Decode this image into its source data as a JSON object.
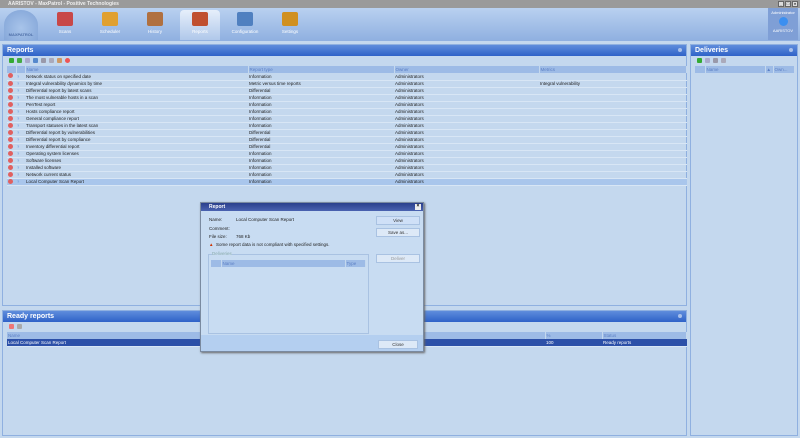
{
  "window": {
    "title": "AARISTOV - MaxPatrol - Positive Technologies",
    "controls": [
      "_",
      "□",
      "×"
    ]
  },
  "logo": "MAXPATROL",
  "tabs": [
    {
      "label": "Scans",
      "color": "#c84848"
    },
    {
      "label": "Scheduler",
      "color": "#e0a030"
    },
    {
      "label": "History",
      "color": "#b07040"
    },
    {
      "label": "Reports",
      "color": "#c05030"
    },
    {
      "label": "Configuration",
      "color": "#5080c0"
    },
    {
      "label": "Settings",
      "color": "#d09020"
    }
  ],
  "active_tab": "Reports",
  "admin": {
    "role": "Administrator",
    "user": "AARISTOV"
  },
  "reports": {
    "title": "Reports",
    "columns": [
      "Name",
      "Report type",
      "Owner",
      "Metrics"
    ],
    "rows": [
      [
        "Network status on specified date",
        "Information",
        "Administrators",
        ""
      ],
      [
        "Integral vulnerability dynamics by time",
        "Metric versus time reports",
        "Administrators",
        "Integral vulnerability"
      ],
      [
        "Differential report by latest scans",
        "Differential",
        "Administrators",
        ""
      ],
      [
        "The most vulnerable hosts in a scan",
        "Information",
        "Administrators",
        ""
      ],
      [
        "PenTest report",
        "Information",
        "Administrators",
        ""
      ],
      [
        "Hosts compliance report",
        "Information",
        "Administrators",
        ""
      ],
      [
        "General compliance report",
        "Information",
        "Administrators",
        ""
      ],
      [
        "Transport statuses in the latest scan",
        "Information",
        "Administrators",
        ""
      ],
      [
        "Differential report by vulnerabilities",
        "Differential",
        "Administrators",
        ""
      ],
      [
        "Differential report by compliance",
        "Differential",
        "Administrators",
        ""
      ],
      [
        "Inventory differential report",
        "Differential",
        "Administrators",
        ""
      ],
      [
        "Operating system licenses",
        "Information",
        "Administrators",
        ""
      ],
      [
        "Software licenses",
        "Information",
        "Administrators",
        ""
      ],
      [
        "Installed software",
        "Information",
        "Administrators",
        ""
      ],
      [
        "Network current status",
        "Information",
        "Administrators",
        ""
      ],
      [
        "Local Computer Scan Report",
        "Information",
        "Administrators",
        ""
      ]
    ],
    "selected_row": 15
  },
  "ready": {
    "title": "Ready reports",
    "columns": [
      "Name",
      "%",
      "Status"
    ],
    "rows": [
      [
        "Local Computer Scan Report",
        "100",
        "Ready reports"
      ]
    ]
  },
  "deliveries": {
    "title": "Deliveries",
    "columns": [
      "Name",
      "Own..."
    ]
  },
  "dialog": {
    "title": "Report",
    "name_label": "Name:",
    "name": "Local Computer Scan Report",
    "comment_label": "Comment:",
    "size_label": "File size:",
    "size": "768 Kb",
    "warning": "Some report data is not compliant with specified settings.",
    "deliveries_label": "Deliveries",
    "columns": [
      "Name",
      "Type"
    ],
    "view": "View",
    "save": "Save as...",
    "deliver": "Deliver",
    "close": "Close"
  }
}
